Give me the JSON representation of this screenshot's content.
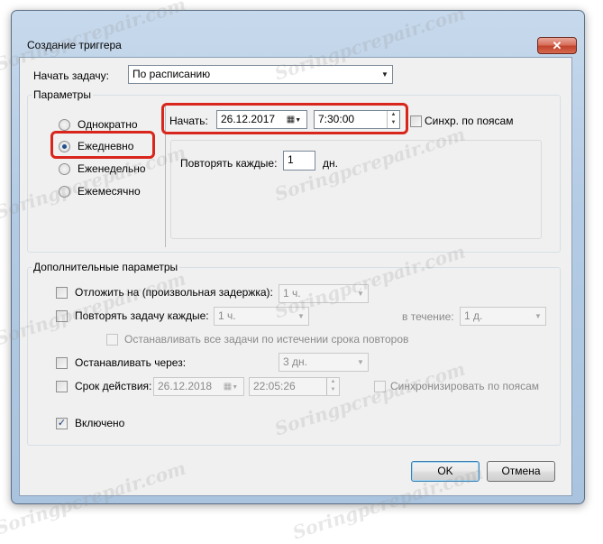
{
  "window": {
    "title": "Создание триггера",
    "close_glyph": "✕"
  },
  "start_task": {
    "label": "Начать задачу:",
    "value": "По расписанию"
  },
  "params": {
    "group_label": "Параметры",
    "radios": [
      {
        "label": "Однократно",
        "checked": false
      },
      {
        "label": "Ежедневно",
        "checked": true
      },
      {
        "label": "Еженедельно",
        "checked": false
      },
      {
        "label": "Ежемесячно",
        "checked": false
      }
    ],
    "start_label": "Начать:",
    "start_date": "26.12.2017",
    "start_time": "7:30:00",
    "sync_label": "Синхр. по поясам",
    "repeat_every_label": "Повторять каждые:",
    "repeat_every_value": "1",
    "repeat_every_unit": "дн."
  },
  "advanced": {
    "group_label": "Дополнительные параметры",
    "delay_label": "Отложить на (произвольная задержка):",
    "delay_value": "1 ч.",
    "repeat_label": "Повторять задачу каждые:",
    "repeat_value": "1 ч.",
    "duration_label": "в течение:",
    "duration_value": "1 д.",
    "stop_all_label": "Останавливать все задачи по истечении срока повторов",
    "stop_after_label": "Останавливать через:",
    "stop_after_value": "3 дн.",
    "expire_label": "Срок действия:",
    "expire_date": "26.12.2018",
    "expire_time": "22:05:26",
    "expire_sync_label": "Синхронизировать по поясам",
    "enabled_label": "Включено",
    "enabled_mark": "✓"
  },
  "buttons": {
    "ok": "OK",
    "cancel": "Отмена"
  },
  "watermark": "Soringpcrepair.com",
  "icons": {
    "dropdown": "▼",
    "calendar": "▦",
    "spin_up": "▲",
    "spin_down": "▼"
  }
}
